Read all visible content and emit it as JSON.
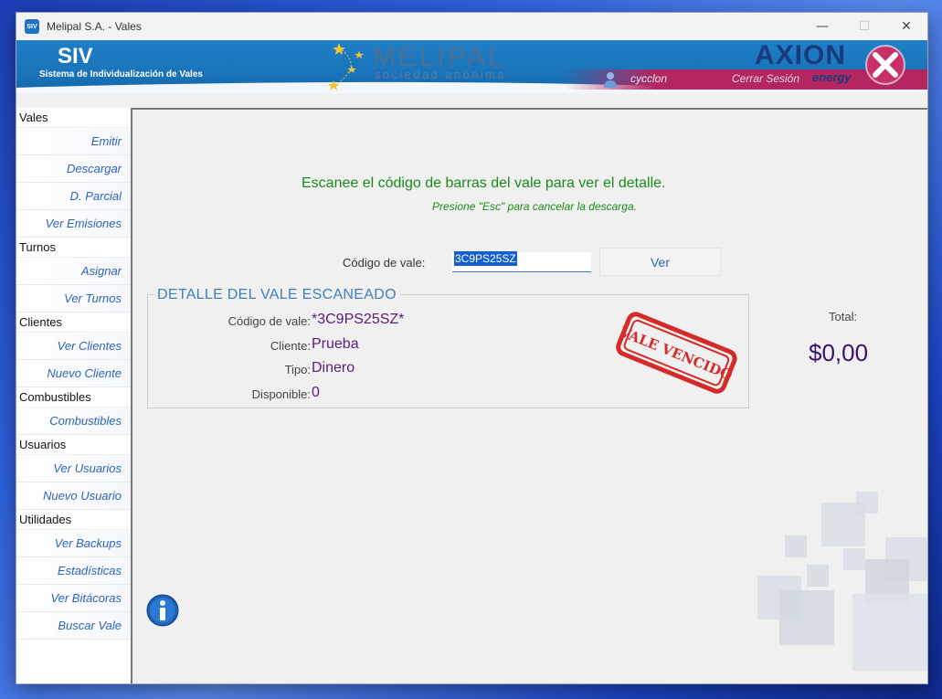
{
  "window": {
    "title": "Melipal S.A. - Vales",
    "app_icon_text": "SIV",
    "minimize": "—",
    "maximize": "☐",
    "close": "✕"
  },
  "header": {
    "app_name": "SIV",
    "app_subtitle": "Sistema de Individualización de Vales",
    "company_logo": "MELIPAL",
    "company_logo_sub": "sociedad anónima",
    "user": "cycclon",
    "logout": "Cerrar Sesión",
    "brand_logo": "AXION",
    "brand_logo_sub": "energy"
  },
  "sidebar": {
    "groups": [
      {
        "label": "Vales",
        "items": [
          {
            "label": "Emitir"
          },
          {
            "label": "Descargar"
          },
          {
            "label": "D. Parcial"
          },
          {
            "label": "Ver Emisiones"
          }
        ]
      },
      {
        "label": "Turnos",
        "items": [
          {
            "label": "Asignar"
          },
          {
            "label": "Ver Turnos"
          }
        ]
      },
      {
        "label": "Clientes",
        "items": [
          {
            "label": "Ver Clientes"
          },
          {
            "label": "Nuevo Cliente"
          }
        ]
      },
      {
        "label": "Combustibles",
        "items": [
          {
            "label": "Combustibles"
          }
        ]
      },
      {
        "label": "Usuarios",
        "items": [
          {
            "label": "Ver Usuarios"
          },
          {
            "label": "Nuevo Usuario"
          }
        ]
      },
      {
        "label": "Utilidades",
        "items": [
          {
            "label": "Ver Backups"
          },
          {
            "label": "Estadísticas"
          },
          {
            "label": "Ver Bitácoras"
          },
          {
            "label": "Buscar Vale"
          }
        ]
      }
    ]
  },
  "main": {
    "prompt": "Escanee el código de barras del vale para ver el detalle.",
    "hint": "Presione \"Esc\" para cancelar la descarga.",
    "code_label": "Código de vale:",
    "code_value": "3C9PS25SZ",
    "ver_button": "Ver",
    "detail": {
      "legend": "DETALLE DEL VALE ESCANEADO",
      "code_label": "Código de vale:",
      "code_value": "*3C9PS25SZ*",
      "client_label": "Cliente:",
      "client_value": "Prueba",
      "type_label": "Tipo:",
      "type_value": "Dinero",
      "available_label": "Disponible:",
      "available_value": "0",
      "stamp": "VALE VENCIDO"
    },
    "total_label": "Total:",
    "total_value": "$0,00"
  },
  "colors": {
    "accent": "#1f7fc7",
    "link": "#2e62b8",
    "prompt": "#1a8a1a",
    "value": "#5a1a7a",
    "stamp": "#d42a2a"
  }
}
